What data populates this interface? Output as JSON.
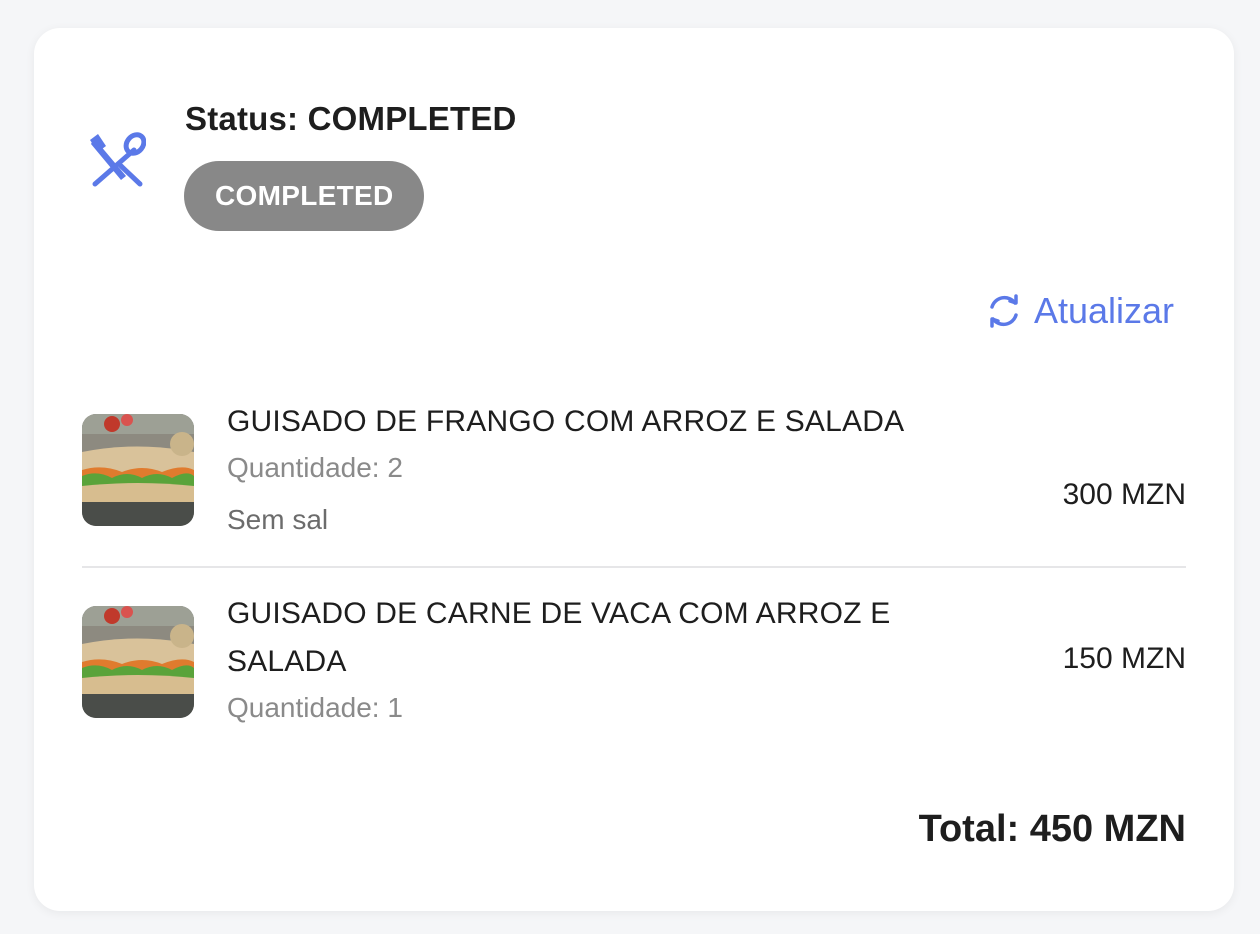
{
  "order": {
    "status_title": "Status: COMPLETED",
    "status_badge": "COMPLETED",
    "header_icon": "utensils-icon",
    "refresh": {
      "label": "Atualizar",
      "icon": "refresh-icon"
    },
    "items": [
      {
        "name": "GUISADO DE FRANGO COM ARROZ E SALADA",
        "quantity": "Quantidade: 2",
        "note": "Sem sal",
        "price": "300 MZN",
        "thumbnail": "sandwich-image"
      },
      {
        "name": "GUISADO DE CARNE DE VACA COM ARROZ E SALADA",
        "quantity": "Quantidade: 1",
        "price": "150 MZN",
        "thumbnail": "sandwich-image"
      }
    ],
    "total": "Total: 450 MZN"
  },
  "colors": {
    "accent": "#5b79e8",
    "badge_bg": "#888888",
    "page_bg": "#f5f6f8",
    "card_bg": "#ffffff",
    "muted_text": "#8a8a8a"
  }
}
